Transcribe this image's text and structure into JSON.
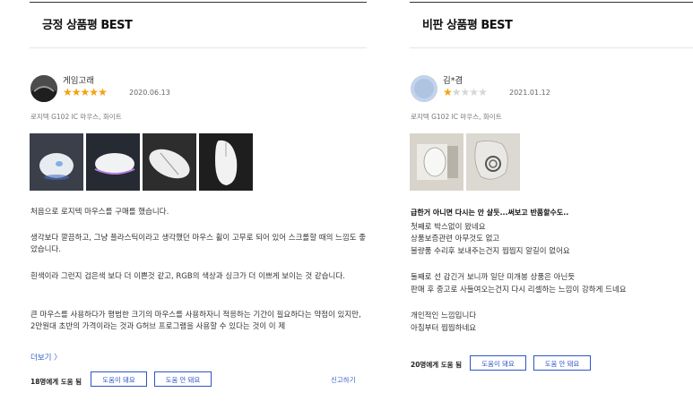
{
  "positive": {
    "title": "긍정 상품평 BEST",
    "nickname": "게임고래",
    "rating": 5,
    "max_rating": 5,
    "date": "2020.06.13",
    "option": "로지텍 G102 IC 마우스, 화이트",
    "paragraphs": [
      "처음으로 로지텍 마우스를 구매를 했습니다.",
      "생각보다 깔끔하고, 그냥 플라스틱이라고 생각했던 마우스 휠이 고무로 되어 있어 스크롤할 때의 느낌도 좋았습니다.",
      "흰색이라 그런지 검은색 보다 더 이쁜것 같고, RGB의 색상과 싱크가 더 이쁘게 보이는 것 같습니다.",
      "큰 마우스를 사용하다가 평범한 크기의 마우스를 사용하자니 적응하는 기간이 필요하다는 약점이 있지만, 2만원대 초반의 가격이라는 것과 G허브 프로그램을 사용할 수 있다는 것이 이 제"
    ],
    "more": "더보기 〉",
    "helpful_count": "18명에게 도움 됨",
    "helpful_yes": "도움이 돼요",
    "helpful_no": "도움 안 돼요",
    "report": "신고하기"
  },
  "negative": {
    "title": "비판 상품평 BEST",
    "nickname": "김*겸",
    "rating": 1,
    "max_rating": 5,
    "date": "2021.01.12",
    "option": "로지텍 G102 IC 마우스, 화이트",
    "headline": "급한거 아니면 다시는 안 살듯...써보고 반품할수도..",
    "paragraphs": [
      "첫째로 박스없이 왔네요",
      "상품보증관련 아무것도 없고",
      "불량품 수리후 보내주는건지 찝찝지 알길이 없어요",
      "둘째로 선 감긴거 보니까 일단 미개봉 상품은 아닌듯",
      "판매 후 중고로 사들여오는건지 다시 리셀하는 느낌이 강하게 드네요",
      "개인적인 느낌입니다",
      "아침부터 찝찝하네요"
    ],
    "helpful_count": "20명에게 도움 됨",
    "helpful_yes": "도움이 돼요",
    "helpful_no": "도움 안 돼요"
  },
  "colors": {
    "star_on": "#f3a20e",
    "star_off": "#d6d6d6",
    "accent": "#2f55c6",
    "link": "#3a63c8"
  },
  "icons": {
    "star": "★"
  }
}
